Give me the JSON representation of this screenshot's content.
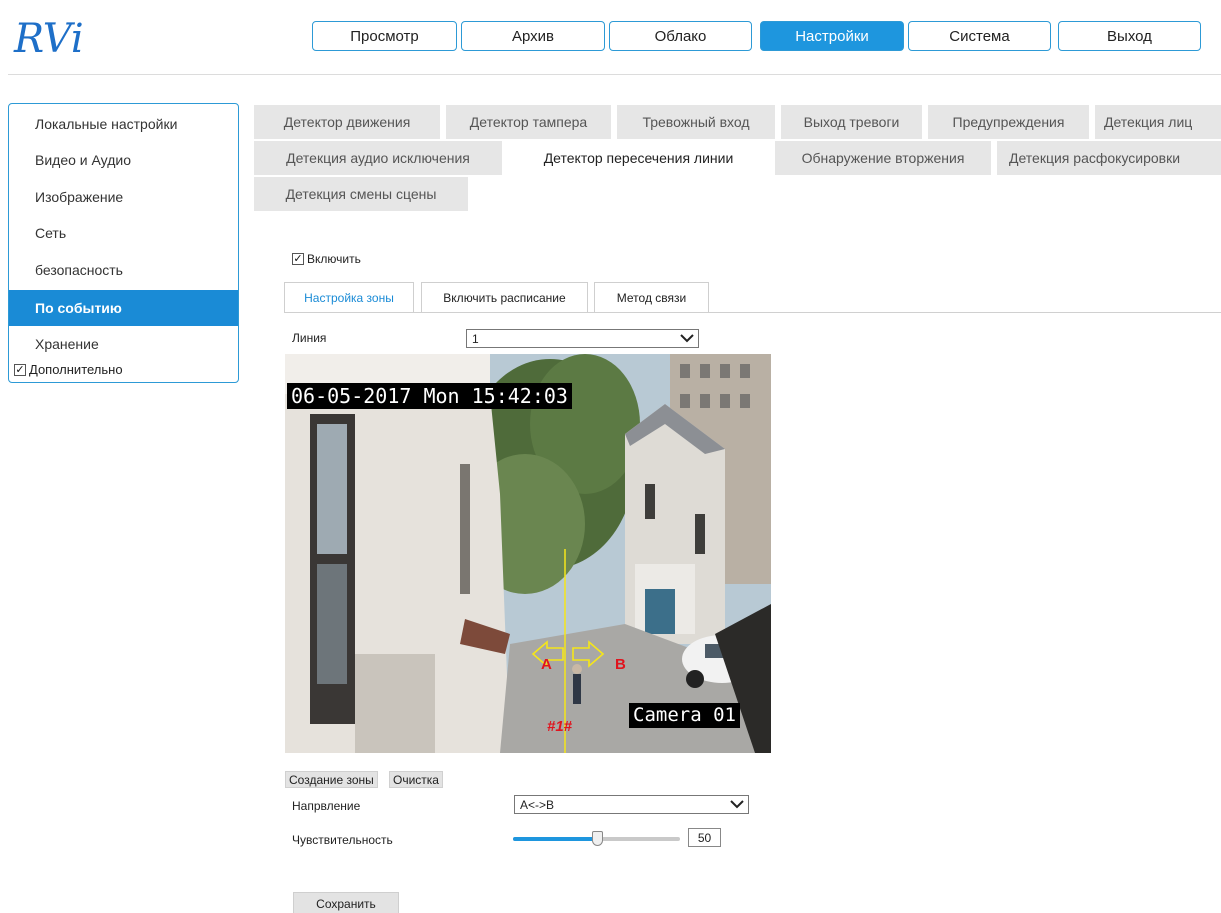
{
  "brand": {
    "logo_text": "RVi",
    "color": "#1e6fc8"
  },
  "topnav": {
    "items": [
      {
        "label": "Просмотр"
      },
      {
        "label": "Архив"
      },
      {
        "label": "Облако"
      },
      {
        "label": "Настройки",
        "active": true
      },
      {
        "label": "Система"
      },
      {
        "label": "Выход"
      }
    ]
  },
  "sidebar": {
    "items": [
      {
        "label": "Локальные настройки"
      },
      {
        "label": "Видео и Аудио"
      },
      {
        "label": "Изображение"
      },
      {
        "label": "Сеть"
      },
      {
        "label": "безопасность"
      },
      {
        "label": "По событию",
        "active": true
      },
      {
        "label": "Хранение"
      }
    ],
    "advanced_label": "Дополнительно",
    "advanced_checked": true
  },
  "event_tabs": {
    "row1": [
      "Детектор движения",
      "Детектор тампера",
      "Тревожный вход",
      "Выход тревоги",
      "Предупреждения",
      "Детекция лиц"
    ],
    "row2": [
      "Детекция аудио исключения",
      "Детектор пересечения линии",
      "Обнаружение вторжения",
      "Детекция расфокусировки"
    ],
    "row3": [
      "Детекция смены сцены"
    ],
    "active": "Детектор пересечения линии"
  },
  "content": {
    "enable_label": "Включить",
    "enable_checked": true,
    "subtabs": [
      "Настройка зоны",
      "Включить расписание",
      "Метод связи"
    ],
    "active_subtab": "Настройка зоны",
    "line_label": "Линия",
    "line_value": "1",
    "video": {
      "timestamp": "06-05-2017 Mon 15:42:03",
      "camera_name": "Camera 01",
      "line_id": "#1#",
      "side_a": "A",
      "side_b": "B"
    },
    "create_zone_label": "Создание зоны",
    "clear_label": "Очистка",
    "direction_label": "Напрвление",
    "direction_value": "A<->B",
    "sensitivity_label": "Чувствительность",
    "sensitivity_value": "50",
    "sensitivity_fraction": 0.5,
    "save_label": "Сохранить"
  },
  "colors": {
    "accent": "#1e96de",
    "tab_inactive": "#e6e6e6",
    "detection_line": "#f5e61a",
    "label_red": "#e0141e"
  }
}
